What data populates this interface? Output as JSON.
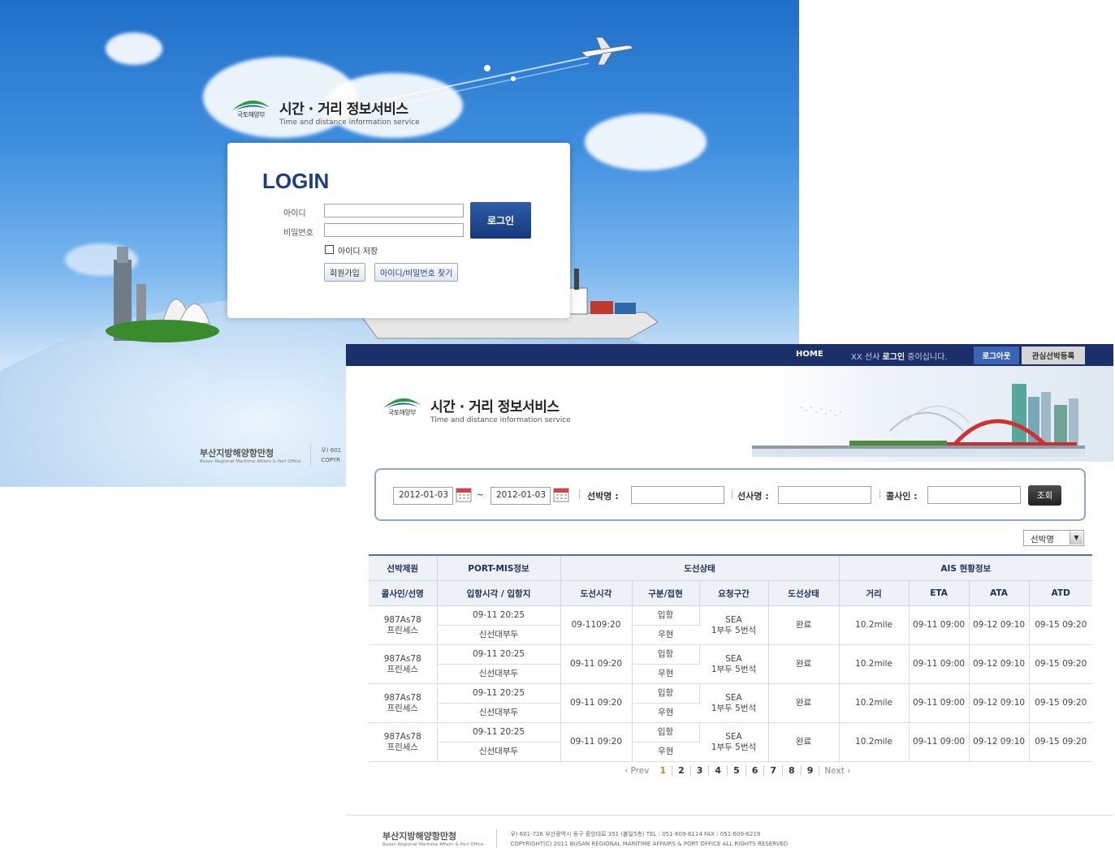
{
  "login_screen": {
    "brand": {
      "ministry": "국토해양부",
      "title": "시간 · 거리 정보서비스",
      "subtitle": "Time and distance information service"
    },
    "login_box": {
      "heading": "LOGIN",
      "id_label": "아이디",
      "password_label": "비밀번호",
      "id_value": "",
      "password_value": "",
      "login_button": "로그인",
      "remember_label": "아이디 저장",
      "remember_checked": false,
      "join_button": "회원가입",
      "find_button": "아이디/비밀번호 찾기"
    },
    "footer": {
      "org_name": "부산지방해양항만청",
      "org_name_en": "Busan Regional Maritime Affairs & Port Office",
      "address_fragment": "우) 601",
      "copyright_fragment": "COPYR"
    }
  },
  "main_screen": {
    "topbar": {
      "home": "HOME",
      "user_prefix": "XX 선사",
      "user_bold": "로그인",
      "user_suffix": "중이십니다.",
      "logout": "로그아웃",
      "watch_register": "관심선박등록"
    },
    "brand": {
      "ministry": "국토해양부",
      "title": "시간 · 거리 정보서비스",
      "subtitle": "Time and distance information service"
    },
    "search": {
      "date_from": "2012-01-03",
      "tilde": "~",
      "date_to": "2012-01-03",
      "ship_name_label": "선박명 :",
      "ship_company_label": "선사명 :",
      "call_sign_label": "콜사인 :",
      "ship_name_value": "",
      "ship_company_value": "",
      "call_sign_value": "",
      "query_button": "조회"
    },
    "sort_select": {
      "selected": "선박명"
    },
    "table": {
      "group_headers": [
        "선박제원",
        "PORT-MIS정보",
        "도선상태",
        "AIS 현황정보"
      ],
      "columns": [
        "콜사인/선명",
        "입항시각 / 입항지",
        "도선시각",
        "구분/접현",
        "요청구간",
        "도선상태",
        "거리",
        "ETA",
        "ATA",
        "ATD"
      ],
      "rows": [
        {
          "call_sign": "987As78",
          "ship": "프린세스",
          "arrival_time": "09-11 20:25",
          "arrival_port": "신선대부두",
          "pilot_time": "09-1109:20",
          "type": "입항",
          "berthing": "우현",
          "section_1": "SEA",
          "section_2": "1부두 5번석",
          "status": "완료",
          "distance": "10.2mile",
          "eta": "09-11 09:00",
          "ata": "09-12 09:10",
          "atd": "09-15 09:20"
        },
        {
          "call_sign": "987As78",
          "ship": "프린세스",
          "arrival_time": "09-11 20:25",
          "arrival_port": "신선대부두",
          "pilot_time": "09-11 09:20",
          "type": "입항",
          "berthing": "우현",
          "section_1": "SEA",
          "section_2": "1부두 5번석",
          "status": "완료",
          "distance": "10.2mile",
          "eta": "09-11 09:00",
          "ata": "09-12 09:10",
          "atd": "09-15 09:20"
        },
        {
          "call_sign": "987As78",
          "ship": "프린세스",
          "arrival_time": "09-11 20:25",
          "arrival_port": "신선대부두",
          "pilot_time": "09-11 09:20",
          "type": "입항",
          "berthing": "우현",
          "section_1": "SEA",
          "section_2": "1부두 5번석",
          "status": "완료",
          "distance": "10.2mile",
          "eta": "09-11 09:00",
          "ata": "09-12 09:10",
          "atd": "09-15 09:20"
        },
        {
          "call_sign": "987As78",
          "ship": "프린세스",
          "arrival_time": "09-11 20:25",
          "arrival_port": "신선대부두",
          "pilot_time": "09-11 09:20",
          "type": "입항",
          "berthing": "우현",
          "section_1": "SEA",
          "section_2": "1부두 5번석",
          "status": "완료",
          "distance": "10.2mile",
          "eta": "09-11 09:00",
          "ata": "09-12 09:10",
          "atd": "09-15 09:20"
        }
      ]
    },
    "pagination": {
      "prev": "‹ Prev",
      "next": "Next ›",
      "pages": [
        "1",
        "2",
        "3",
        "4",
        "5",
        "6",
        "7",
        "8",
        "9"
      ],
      "current": "1"
    },
    "footer": {
      "org_name": "부산지방해양항만청",
      "org_name_en": "Busan Regional Maritime Affairs & Port Office",
      "address": "우) 601-726 부산광역시 동구 중앙대로 351 (불일5층) TEL : 051-609-6114 FAX : 051-609-6219",
      "copyright": "COPYRIGHT(C) 2011 BUSAN REGIONAL MARITIME AFFAIRS & PORT OFFICE ALL RIGHTS RESERVED"
    }
  },
  "colors": {
    "navy": "#1b2f6a",
    "brand_blue": "#1c3d82",
    "active_page": "#e27b1a",
    "logo_green": "#2a9a3c"
  }
}
